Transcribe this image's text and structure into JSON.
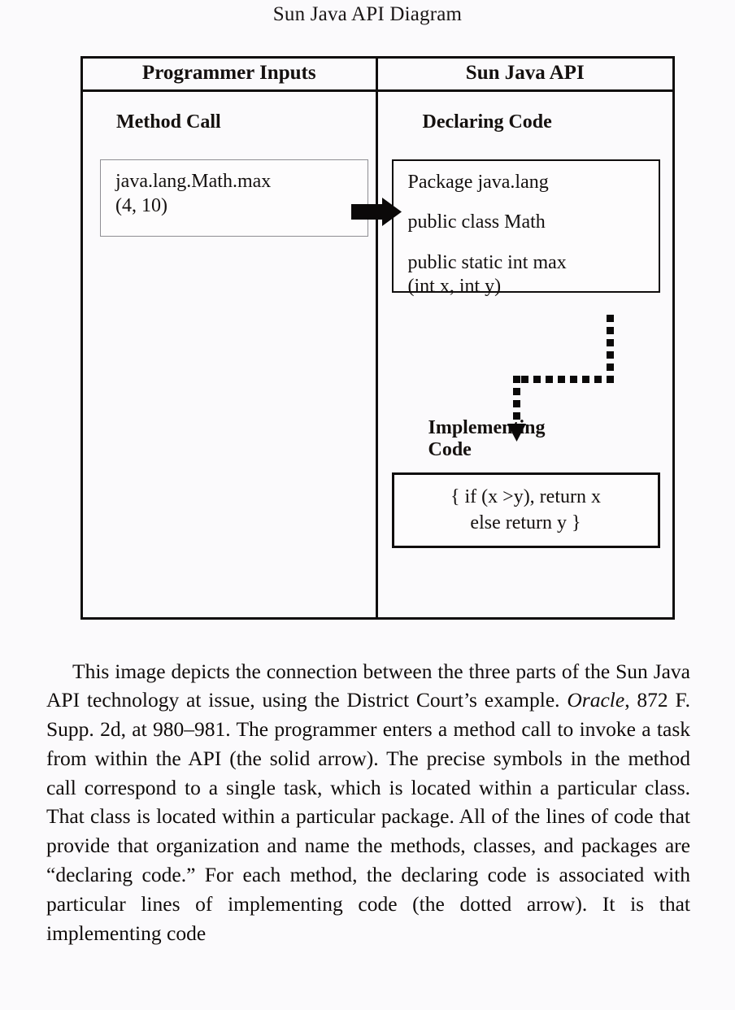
{
  "figure": {
    "title": "Sun Java API Diagram",
    "columns": [
      {
        "header": "Programmer Inputs"
      },
      {
        "header": "Sun Java API"
      }
    ],
    "left_column": {
      "section_title": "Method Call",
      "box_lines": [
        "java.lang.Math.max",
        "(4, 10)"
      ]
    },
    "right_column": {
      "declaring": {
        "section_title": "Declaring Code",
        "code_lines": [
          "Package java.lang",
          "public class Math",
          "public static int max",
          "(int x, int y)"
        ]
      },
      "implementing": {
        "section_title_line1": "Implementing",
        "section_title_line2": "Code",
        "code_lines": [
          "{ if (x >y), return x",
          "else return y }"
        ]
      }
    },
    "arrows": [
      {
        "name": "solid-arrow",
        "style": "solid",
        "from": "Method Call",
        "to": "Declaring Code"
      },
      {
        "name": "dotted-arrow",
        "style": "dotted",
        "from": "Declaring Code",
        "to": "Implementing Code"
      }
    ]
  },
  "body": {
    "paragraph_part1": "This image depicts the connection between the three parts of the Sun Java API technology at issue, using the District Court’s example. ",
    "citation_italic": "Oracle",
    "paragraph_part2": ", 872 F. Supp. 2d, at 980–981.  The programmer enters a method call to invoke a task from within the API (the solid arrow).  The precise symbols in the method call correspond to a single task, which is located within a particular class.  That class is located within a particular package.  All of the lines of code that provide that organization and name the methods, classes, and packages are “declaring code.”  For each method, the declaring code is associated with particular lines of implementing code (the dotted arrow).  It is that implementing code"
  },
  "colors": {
    "page_background": "#fbfafc",
    "ink": "#100d0d",
    "box_border_thin": "#8e8e93"
  }
}
